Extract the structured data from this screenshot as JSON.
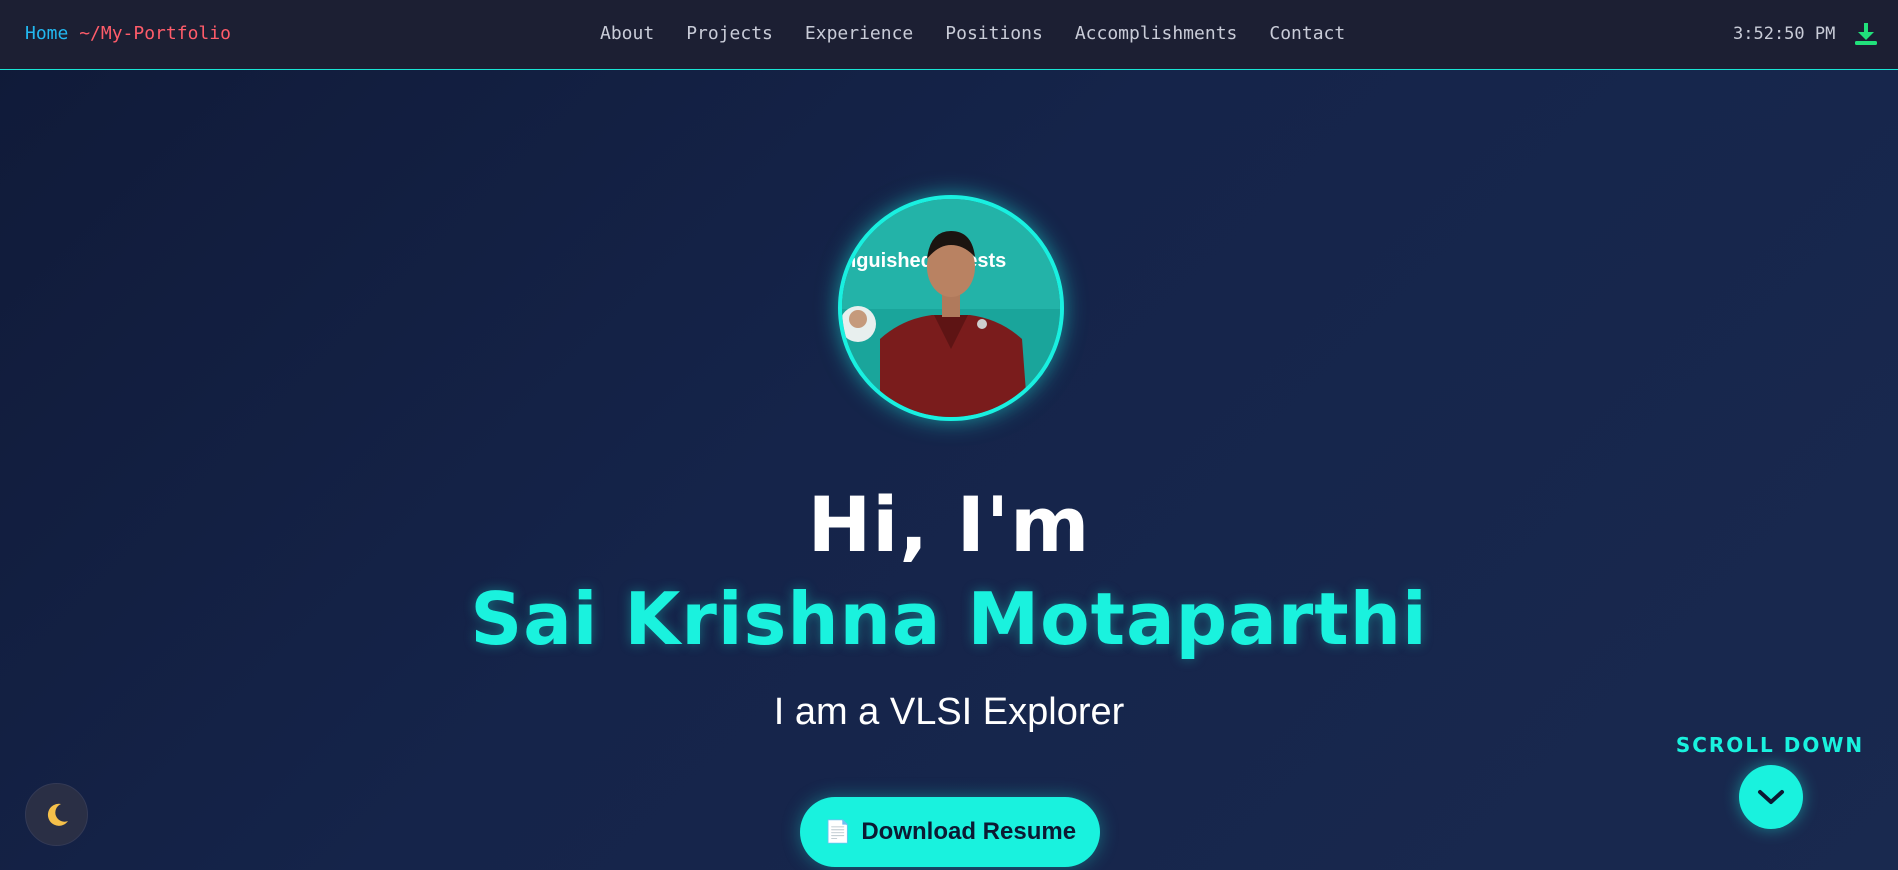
{
  "navbar": {
    "brand_home": "Home",
    "brand_path": "~/My-Portfolio",
    "links": [
      "About",
      "Projects",
      "Experience",
      "Positions",
      "Accomplishments",
      "Contact"
    ],
    "clock": "3:52:50 PM",
    "download_icon": "download-icon"
  },
  "hero": {
    "greeting": "Hi, I'm",
    "name": "Sai Krishna Motaparthi",
    "tagline": "I am a VLSI Explorer",
    "resume_icon": "📄",
    "resume_label": "Download Resume",
    "photo_banner_text": "nguished Guests"
  },
  "scroll": {
    "label": "SCROLL DOWN",
    "icon": "chevron-down-icon"
  },
  "theme_toggle": {
    "icon": "moon-icon",
    "glyph": "🌙"
  },
  "colors": {
    "accent": "#19f2de",
    "navbar_bg": "#1c1f33",
    "brand_home": "#22b8f0",
    "brand_path": "#ff5c6a",
    "background": "#15244a",
    "download_icon": "#21e17b"
  }
}
